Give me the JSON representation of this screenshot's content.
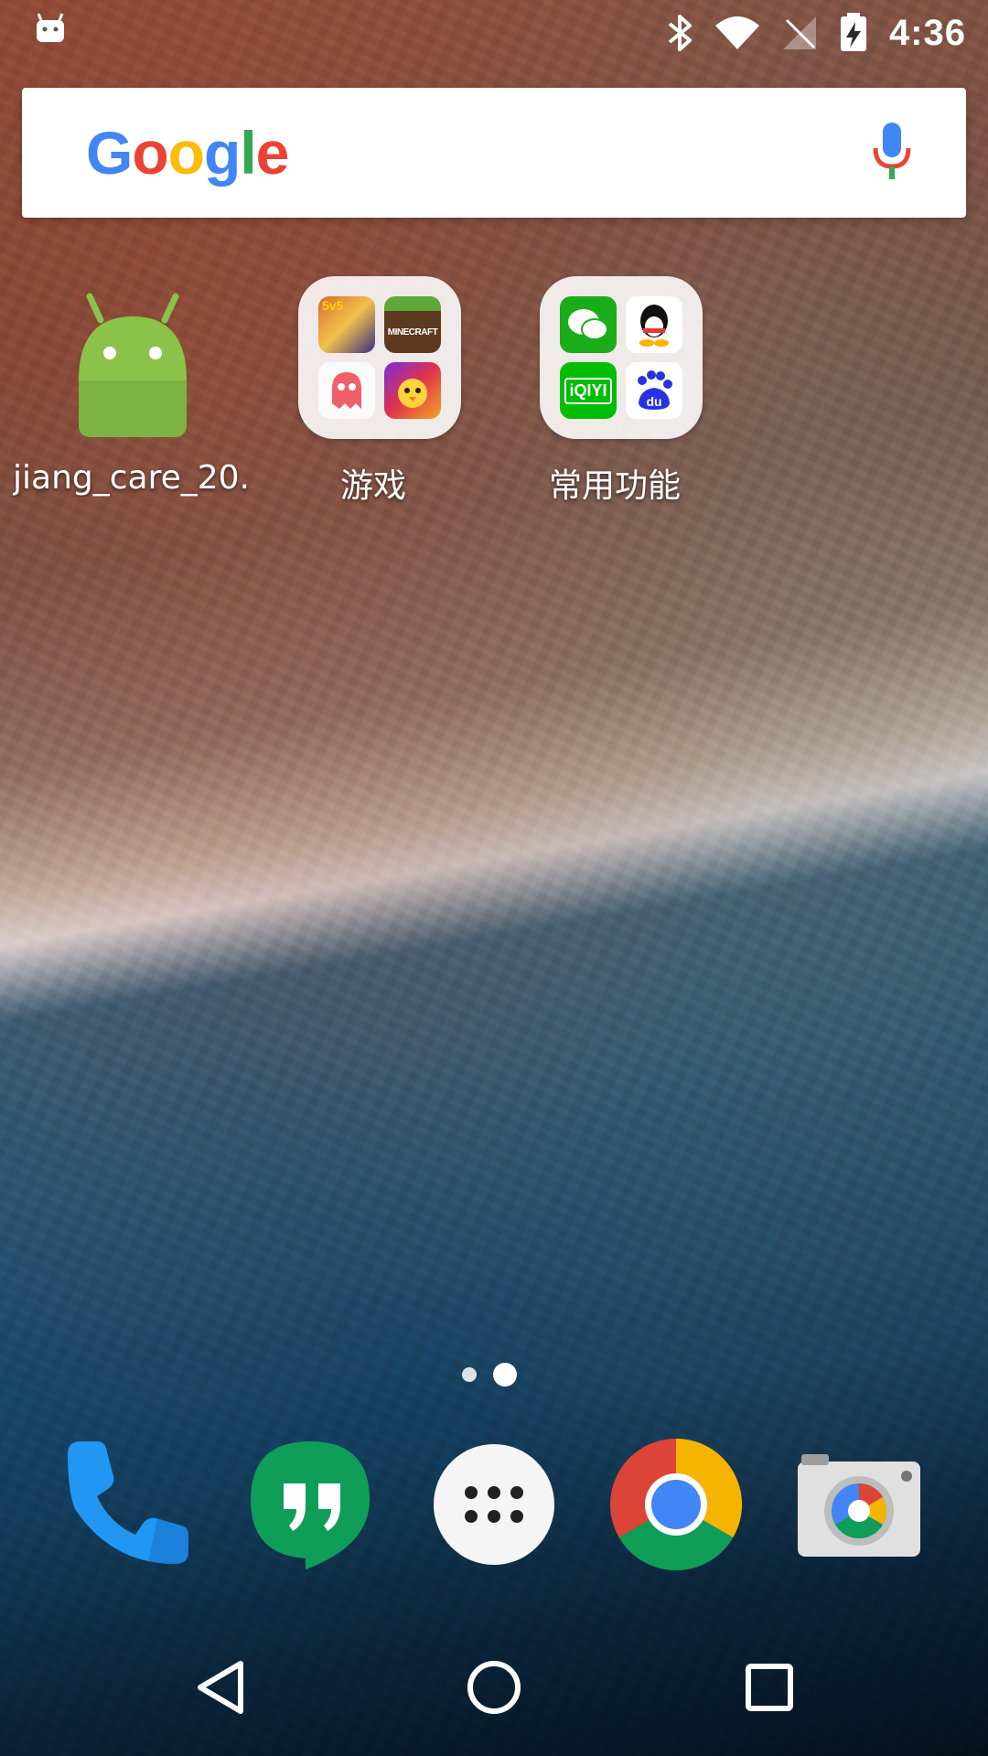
{
  "status_bar": {
    "time": "4:36",
    "icons": [
      "android-notification-icon",
      "bluetooth-icon",
      "wifi-icon",
      "no-signal-icon",
      "battery-charging-icon"
    ]
  },
  "search_bar": {
    "logo_letters": [
      "G",
      "o",
      "o",
      "g",
      "l",
      "e"
    ],
    "mic_icon": "mic-icon"
  },
  "home": {
    "items": [
      {
        "label": "jiang_care_20..",
        "icon": "android-app-icon"
      },
      {
        "label": "游戏",
        "icon": "folder-icon",
        "apps": [
          "王者荣耀",
          "MINECRAFT",
          "pacman-ghost-game",
          "chick-game"
        ]
      },
      {
        "label": "常用功能",
        "icon": "folder-icon",
        "apps": [
          "wechat",
          "qq",
          "iQIYI",
          "du"
        ]
      }
    ]
  },
  "page_indicator": {
    "pages": 2,
    "active": 2
  },
  "dock": [
    {
      "name": "phone-icon"
    },
    {
      "name": "hangouts-icon"
    },
    {
      "name": "app-drawer-icon"
    },
    {
      "name": "chrome-icon"
    },
    {
      "name": "camera-icon"
    }
  ],
  "navigation": [
    "back-icon",
    "home-icon",
    "recents-icon"
  ],
  "colors": {
    "google_blue": "#4285F4",
    "google_red": "#EA4335",
    "google_yellow": "#FBBC05",
    "google_green": "#34A853",
    "android_green": "#8BC34A"
  }
}
